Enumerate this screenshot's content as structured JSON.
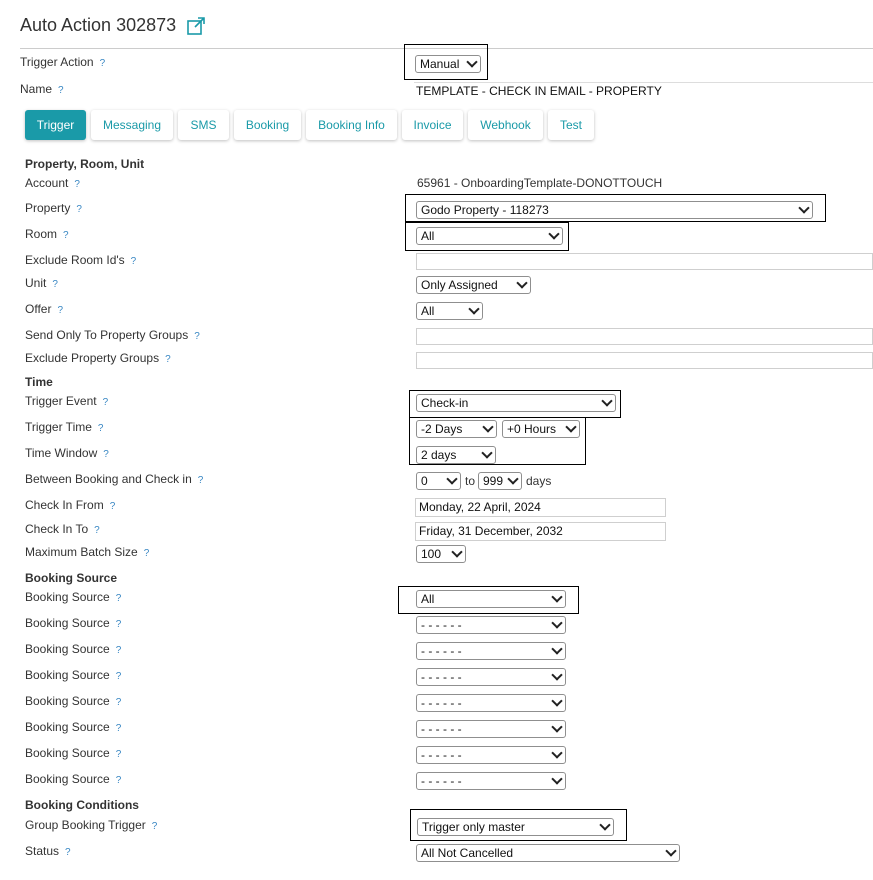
{
  "page": {
    "title": "Auto Action 302873"
  },
  "header": {
    "trigger_action_label": "Trigger Action",
    "trigger_action_value": "Manual",
    "name_label": "Name",
    "name_value": "TEMPLATE - CHECK IN EMAIL - PROPERTY"
  },
  "help_mark": "?",
  "tabs": [
    "Trigger",
    "Messaging",
    "SMS",
    "Booking",
    "Booking Info",
    "Invoice",
    "Webhook",
    "Test"
  ],
  "colors": {
    "accent": "#1a9aa8",
    "help": "#3a88c4"
  },
  "sections": {
    "property": "Property, Room, Unit",
    "time": "Time",
    "booking_source": "Booking Source",
    "booking_conditions": "Booking Conditions"
  },
  "fields": {
    "account_label": "Account",
    "account_value": "65961 - OnboardingTemplate-DONOTTOUCH",
    "property_label": "Property",
    "property_value": "Godo Property - 118273",
    "room_label": "Room",
    "room_value": "All",
    "exclude_room_label": "Exclude Room Id's",
    "exclude_room_value": "",
    "unit_label": "Unit",
    "unit_value": "Only Assigned",
    "offer_label": "Offer",
    "offer_value": "All",
    "send_groups_label": "Send Only To Property Groups",
    "send_groups_value": "",
    "exclude_groups_label": "Exclude Property Groups",
    "exclude_groups_value": "",
    "trigger_event_label": "Trigger Event",
    "trigger_event_value": "Check-in",
    "trigger_time_label": "Trigger Time",
    "trigger_time_days": "-2 Days",
    "trigger_time_hours": "+0 Hours",
    "time_window_label": "Time Window",
    "time_window_value": "2 days",
    "between_label": "Between Booking and Check in",
    "between_from": "0",
    "between_to_word": "to",
    "between_to": "999",
    "between_unit": "days",
    "checkin_from_label": "Check In From",
    "checkin_from_value": "Monday, 22 April, 2024",
    "checkin_to_label": "Check In To",
    "checkin_to_value": "Friday, 31 December, 2032",
    "batch_label": "Maximum Batch Size",
    "batch_value": "100",
    "booking_source_label": "Booking Source",
    "booking_sources": [
      "All",
      "- - - - - -",
      "- - - - - -",
      "- - - - - -",
      "- - - - - -",
      "- - - - - -",
      "- - - - - -",
      "- - - - - -"
    ],
    "group_trigger_label": "Group Booking Trigger",
    "group_trigger_value": "Trigger only master",
    "status_label": "Status",
    "status_value": "All Not Cancelled"
  }
}
